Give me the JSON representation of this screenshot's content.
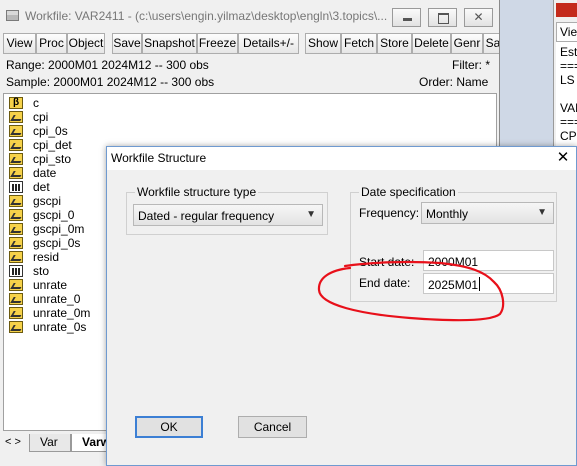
{
  "workfile": {
    "title": "Workfile: VAR2411 - (c:\\users\\engin.yilmaz\\desktop\\engln\\3.topics\\...",
    "caption_buttons": {
      "close": "✕"
    },
    "toolbar": [
      "View",
      "Proc",
      "Object",
      "Save",
      "Snapshot",
      "Freeze",
      "Details+/-",
      "Show",
      "Fetch",
      "Store",
      "Delete",
      "Genr",
      "Sa"
    ],
    "range": "Range:  2000M01 2024M12  --   300 obs",
    "sample": "Sample: 2000M01 2024M12  --   300 obs",
    "filter": "Filter: *",
    "order": "Order: Name",
    "objects": [
      {
        "name": "c",
        "icon": "coef-icon"
      },
      {
        "name": "cpi",
        "icon": "series-icon"
      },
      {
        "name": "cpi_0s",
        "icon": "series-icon"
      },
      {
        "name": "cpi_det",
        "icon": "series-icon"
      },
      {
        "name": "cpi_sto",
        "icon": "series-icon"
      },
      {
        "name": "date",
        "icon": "series-icon"
      },
      {
        "name": "det",
        "icon": "group-icon"
      },
      {
        "name": "gscpi",
        "icon": "series-icon"
      },
      {
        "name": "gscpi_0",
        "icon": "series-icon"
      },
      {
        "name": "gscpi_0m",
        "icon": "series-icon"
      },
      {
        "name": "gscpi_0s",
        "icon": "series-icon"
      },
      {
        "name": "resid",
        "icon": "series-icon"
      },
      {
        "name": "sto",
        "icon": "group-icon"
      },
      {
        "name": "unrate",
        "icon": "series-icon"
      },
      {
        "name": "unrate_0",
        "icon": "series-icon"
      },
      {
        "name": "unrate_0m",
        "icon": "series-icon"
      },
      {
        "name": "unrate_0s",
        "icon": "series-icon"
      }
    ],
    "tabs": {
      "nav": "< >",
      "var": "Var",
      "varw": "Varw"
    }
  },
  "right_window": {
    "view_label": "Viev",
    "lines": [
      "Est",
      "===",
      "LS",
      "",
      "VAR",
      "===",
      "CPI"
    ]
  },
  "dialog": {
    "title": "Workfile Structure",
    "close": "✕",
    "structure_group": "Workfile structure type",
    "structure_value": "Dated - regular frequency",
    "date_group": "Date specification",
    "frequency_label": "Frequency:",
    "frequency_value": "Monthly",
    "start_label": "Start date:",
    "start_value": "2000M01",
    "end_label": "End date:",
    "end_value": "2025M01",
    "ok": "OK",
    "cancel": "Cancel"
  },
  "colors": {
    "annotation": "#e8101a",
    "accent": "#3c7fd4"
  }
}
